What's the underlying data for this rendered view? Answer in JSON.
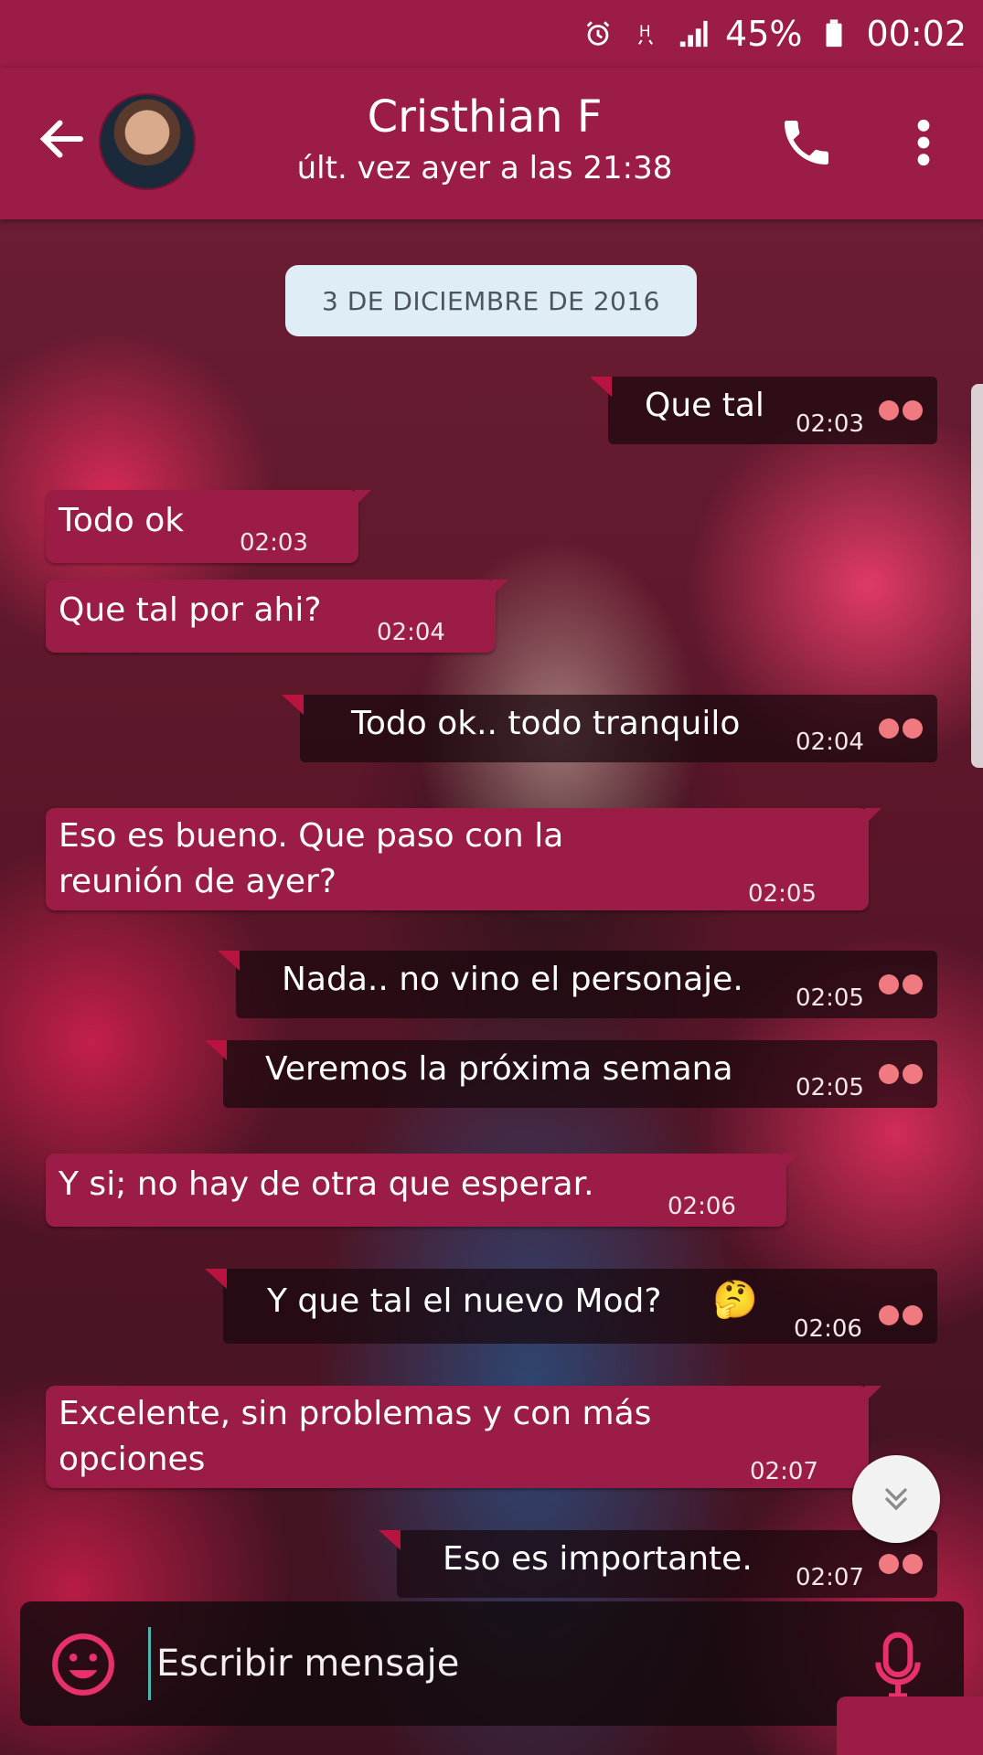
{
  "status_bar": {
    "battery": "45%",
    "time": "00:02",
    "icons": [
      "alarm-icon",
      "h-data-icon",
      "signal-icon",
      "battery-icon"
    ]
  },
  "header": {
    "contact_name": "Cristhian F",
    "last_seen": "últ. vez ayer a las 21:38",
    "icons": [
      "back-arrow-icon",
      "avatar",
      "phone-icon",
      "more-vert-icon"
    ]
  },
  "date_chip": "3 DE DICIEMBRE DE 2016",
  "messages": [
    {
      "dir": "out",
      "text": "Que tal",
      "time": "02:03"
    },
    {
      "dir": "in",
      "text": "Todo ok",
      "time": "02:03"
    },
    {
      "dir": "in",
      "text": "Que tal por ahi?",
      "time": "02:04"
    },
    {
      "dir": "out",
      "text": "Todo ok.. todo tranquilo",
      "time": "02:04"
    },
    {
      "dir": "in",
      "text": "Eso es bueno. Que paso con la reunión de ayer?",
      "time": "02:05"
    },
    {
      "dir": "out",
      "text": "Nada.. no vino el personaje.",
      "time": "02:05"
    },
    {
      "dir": "out",
      "text": "Veremos la próxima semana",
      "time": "02:05"
    },
    {
      "dir": "in",
      "text": "Y si; no hay de otra que esperar.",
      "time": "02:06"
    },
    {
      "dir": "out",
      "text": "Y que tal el nuevo Mod?",
      "emoji": "🤔",
      "time": "02:06"
    },
    {
      "dir": "in",
      "text": "Excelente, sin problemas y con más opciones",
      "time": "02:07"
    },
    {
      "dir": "out",
      "text": "Eso es importante.",
      "time": "02:07"
    }
  ],
  "composer": {
    "placeholder": "Escribir mensaje",
    "icons": [
      "emoji-icon",
      "mic-icon"
    ]
  },
  "colors": {
    "primary": "#9b1c46",
    "tick": "#f07a80",
    "date_chip_bg": "#dfeef6"
  }
}
